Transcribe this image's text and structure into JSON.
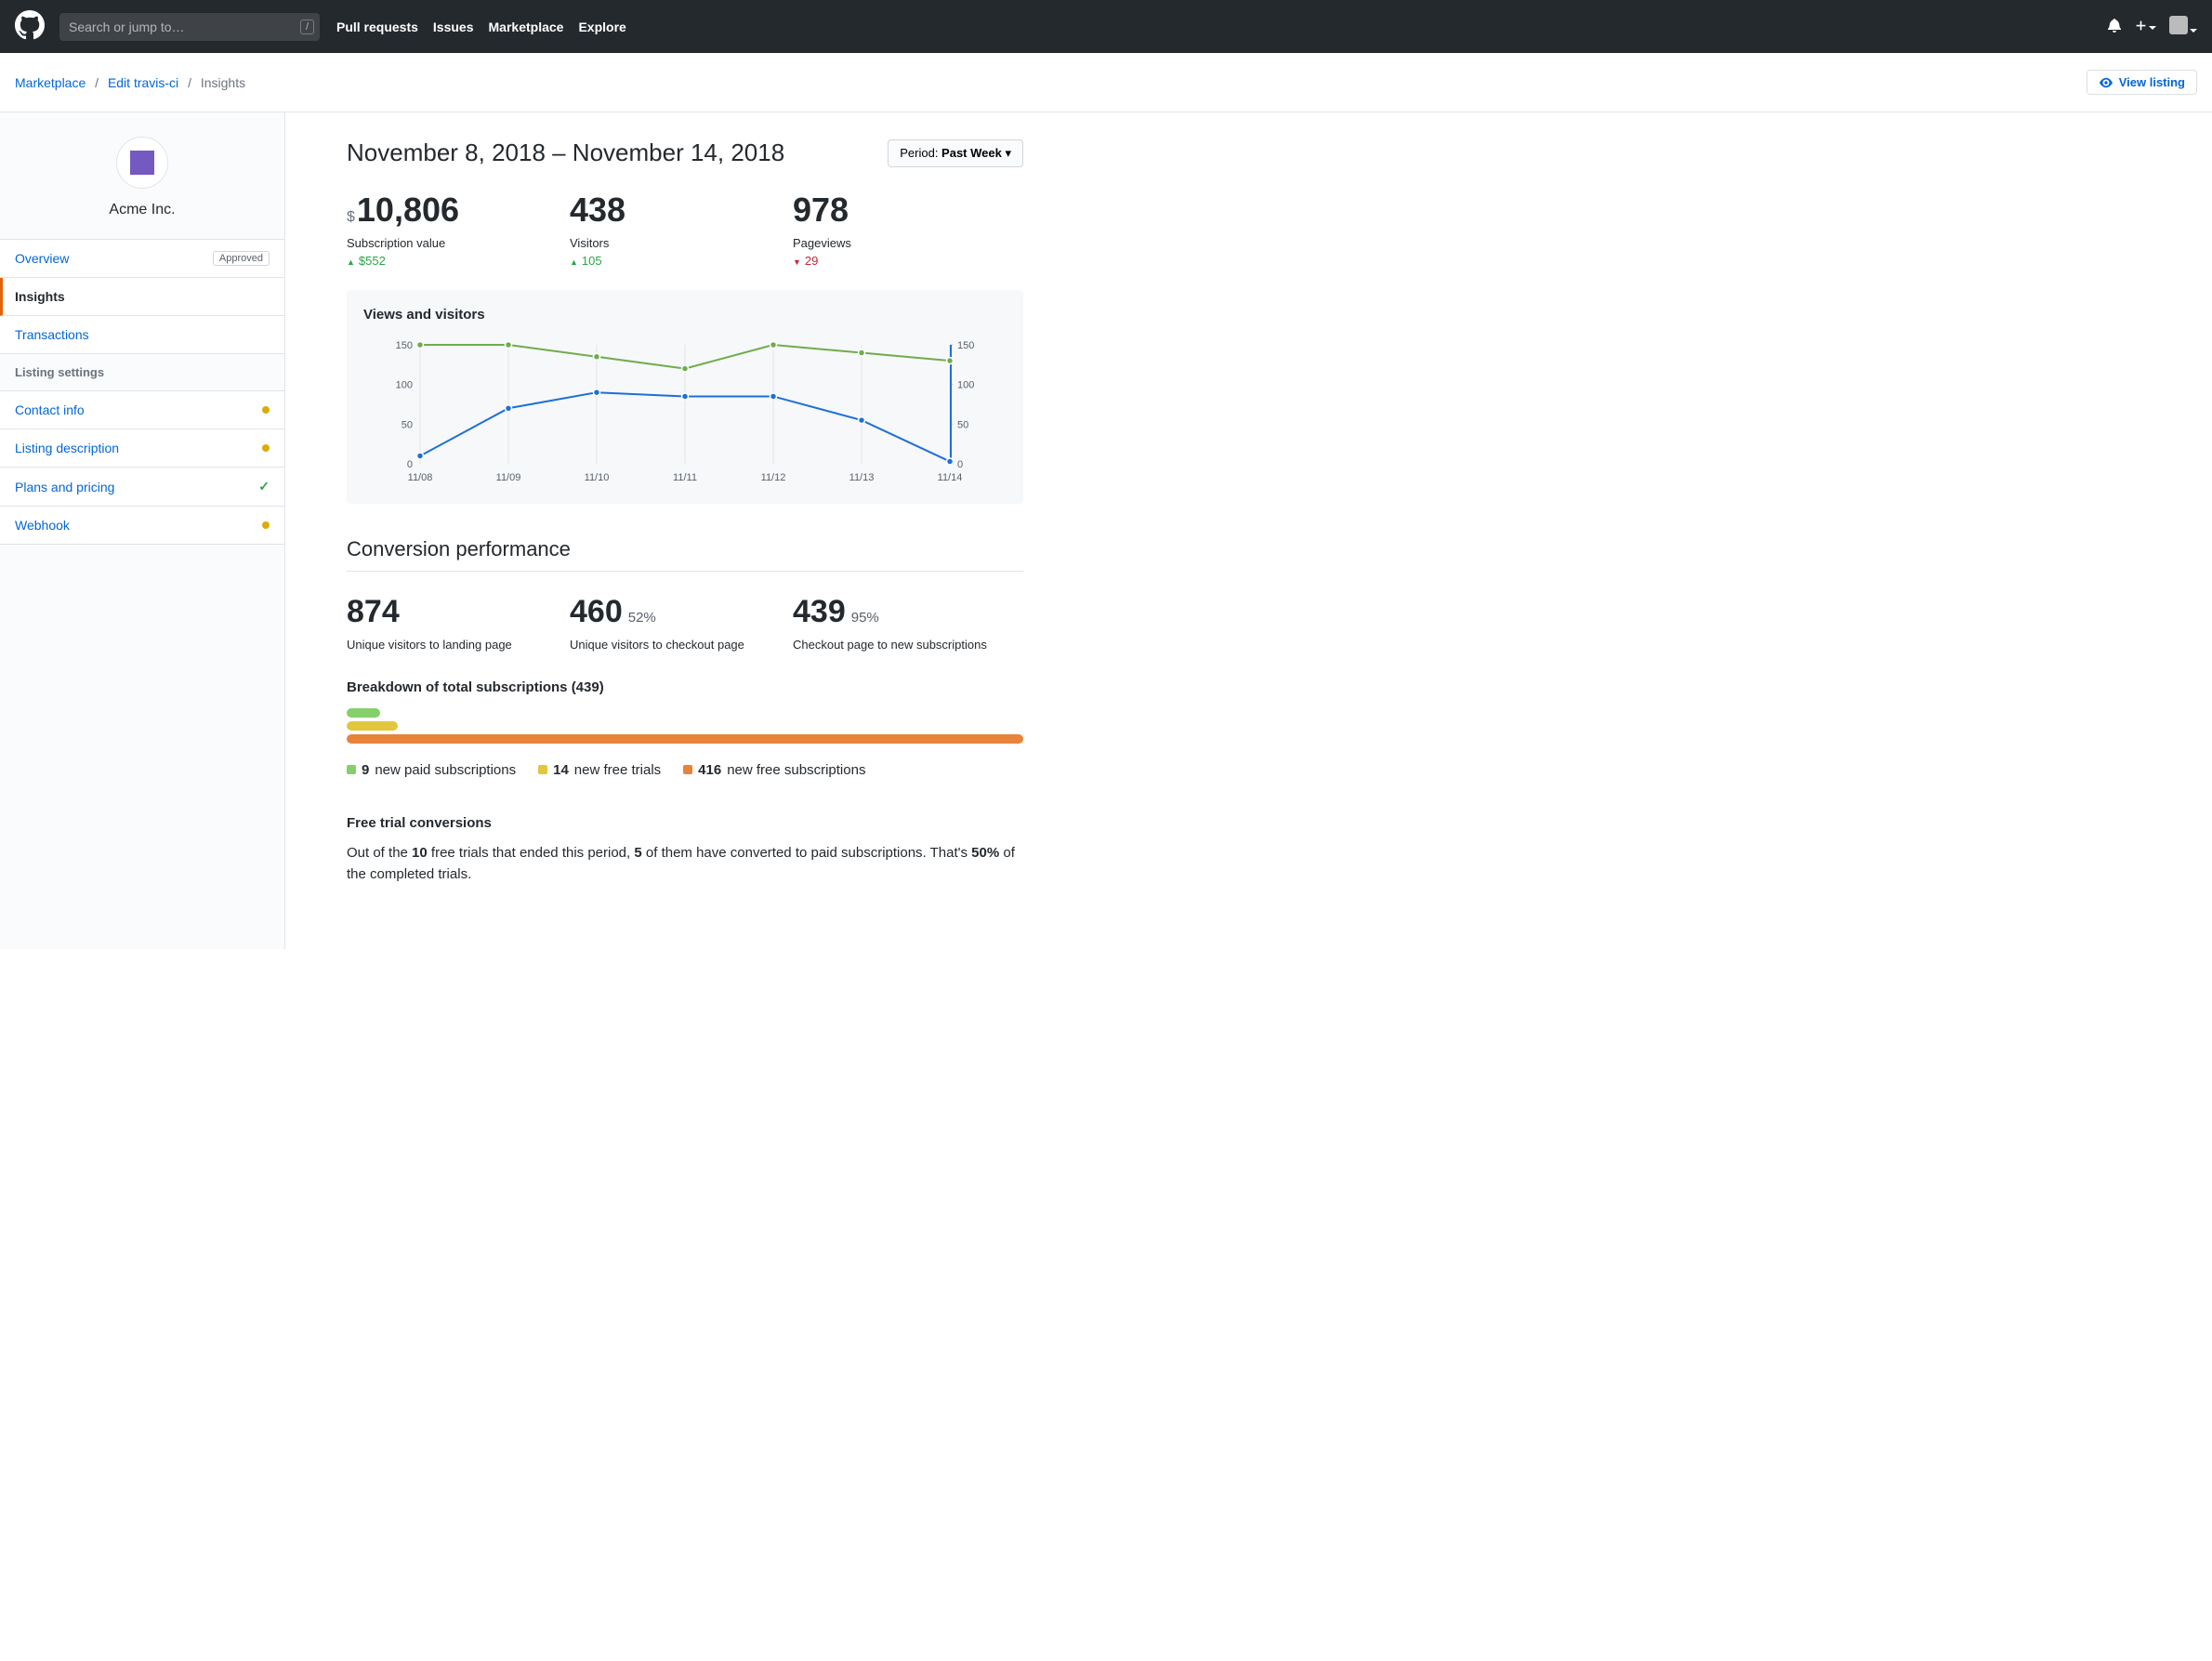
{
  "topnav": {
    "search_placeholder": "Search or jump to…",
    "links": [
      "Pull requests",
      "Issues",
      "Marketplace",
      "Explore"
    ]
  },
  "breadcrumb": {
    "items": [
      "Marketplace",
      "Edit travis-ci",
      "Insights"
    ],
    "view_listing_label": "View listing"
  },
  "sidebar": {
    "app_name": "Acme Inc.",
    "overview_label": "Overview",
    "approved_badge": "Approved",
    "insights_label": "Insights",
    "transactions_label": "Transactions",
    "settings_header": "Listing settings",
    "contact_label": "Contact info",
    "description_label": "Listing description",
    "plans_label": "Plans and pricing",
    "webhook_label": "Webhook"
  },
  "main": {
    "date_range": "November 8, 2018 – November 14, 2018",
    "period_prefix": "Period: ",
    "period_value": "Past Week",
    "metrics": {
      "subscription": {
        "prefix": "$",
        "value": "10,806",
        "label": "Subscription value",
        "delta": "$552",
        "direction": "up"
      },
      "visitors": {
        "value": "438",
        "label": "Visitors",
        "delta": "105",
        "direction": "up"
      },
      "pageviews": {
        "value": "978",
        "label": "Pageviews",
        "delta": "29",
        "direction": "down"
      }
    },
    "chart_title": "Views and visitors",
    "conversion_title": "Conversion performance",
    "conversion": {
      "landing": {
        "value": "874",
        "pct": "",
        "label": "Unique visitors to landing page"
      },
      "checkout": {
        "value": "460",
        "pct": "52%",
        "label": "Unique visitors to checkout page"
      },
      "subs": {
        "value": "439",
        "pct": "95%",
        "label": "Checkout page to new subscriptions"
      }
    },
    "breakdown_title": "Breakdown of total subscriptions (439)",
    "legend": {
      "paid_count": "9",
      "paid_label": " new paid subscriptions",
      "trial_count": "14",
      "trial_label": " new free trials",
      "free_count": "416",
      "free_label": " new free subscriptions"
    },
    "trial": {
      "title": "Free trial conversions",
      "p1a": "Out of the ",
      "p1b": "10",
      "p1c": " free trials that ended this period, ",
      "p1d": "5",
      "p1e": " of them have converted to paid subscriptions. That's ",
      "p1f": "50%",
      "p1g": " of the completed trials."
    }
  },
  "chart_data": {
    "type": "line",
    "title": "Views and visitors",
    "xlabel": "",
    "ylabel": "",
    "ylim_left": [
      0,
      150
    ],
    "ylim_right": [
      0,
      150
    ],
    "categories": [
      "11/08",
      "11/09",
      "11/10",
      "11/11",
      "11/12",
      "11/13",
      "11/14"
    ],
    "left_ticks": [
      0,
      50,
      100,
      150
    ],
    "right_ticks": [
      0,
      50,
      100,
      150
    ],
    "series": [
      {
        "name": "Views",
        "color": "#6fac4b",
        "values": [
          158,
          150,
          135,
          120,
          158,
          140,
          130
        ]
      },
      {
        "name": "Visitors",
        "color": "#1e6fd8",
        "values": [
          10,
          70,
          90,
          85,
          85,
          55,
          3
        ]
      }
    ]
  }
}
